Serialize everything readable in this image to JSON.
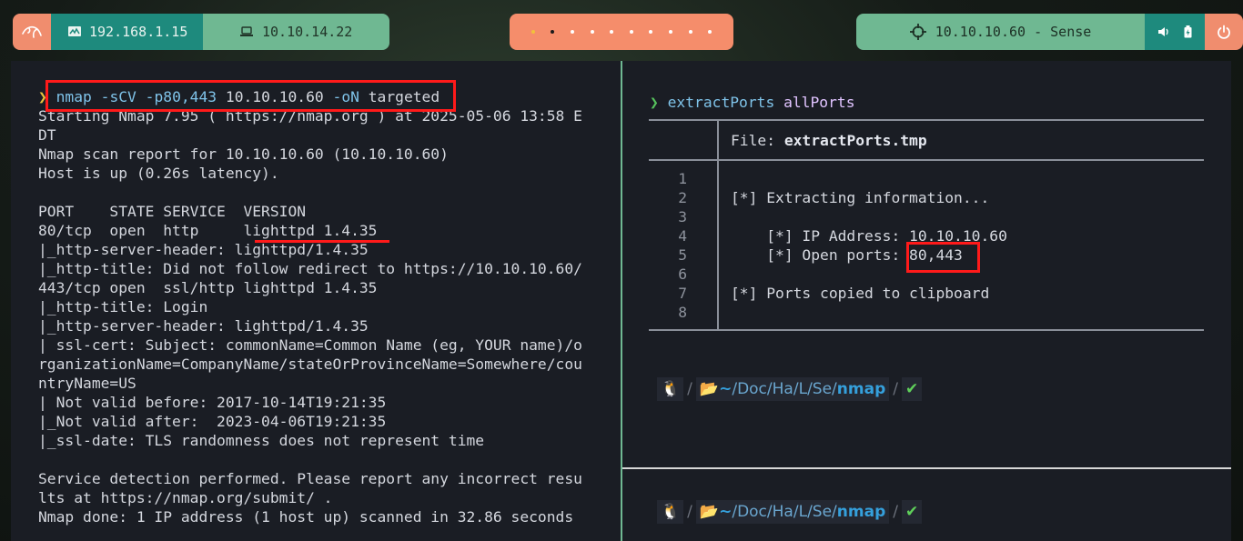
{
  "topbar": {
    "kali_icon": "kali-dragon-icon",
    "local_ip": "192.168.1.15",
    "vpn_ip": "10.10.14.22",
    "target": "10.10.10.60 - Sense",
    "workspaces_count": 10
  },
  "left_pane": {
    "prompt_arrow": "❯",
    "command": {
      "binary": "nmap",
      "args": " -sCV -p80,443 ",
      "ip": "10.10.10.60",
      "flag": " -oN ",
      "outfile": "targeted"
    },
    "output": [
      "Starting Nmap 7.95 ( https://nmap.org ) at 2025-05-06 13:58 E",
      "DT",
      "Nmap scan report for 10.10.10.60 (10.10.10.60)",
      "Host is up (0.26s latency).",
      "",
      "PORT    STATE SERVICE  VERSION",
      "80/tcp  open  http     lighttpd 1.4.35",
      "|_http-server-header: lighttpd/1.4.35",
      "|_http-title: Did not follow redirect to https://10.10.10.60/",
      "443/tcp open  ssl/http lighttpd 1.4.35",
      "|_http-title: Login",
      "|_http-server-header: lighttpd/1.4.35",
      "| ssl-cert: Subject: commonName=Common Name (eg, YOUR name)/o",
      "rganizationName=CompanyName/stateOrProvinceName=Somewhere/cou",
      "ntryName=US",
      "| Not valid before: 2017-10-14T19:21:35",
      "|_Not valid after:  2023-04-06T19:21:35",
      "|_ssl-date: TLS randomness does not represent time",
      "",
      "Service detection performed. Please report any incorrect resu",
      "lts at https://nmap.org/submit/ .",
      "Nmap done: 1 IP address (1 host up) scanned in 32.86 seconds"
    ]
  },
  "right_pane": {
    "prompt_arrow": "❯",
    "command": "extractPorts",
    "arg": "allPorts",
    "file_label": "File: ",
    "file_name": "extractPorts.tmp",
    "line_numbers": [
      "1",
      "2",
      "3",
      "4",
      "5",
      "6",
      "7",
      "8"
    ],
    "lines": [
      "",
      "[*] Extracting information...",
      "",
      "    [*] IP Address: 10.10.10.60",
      "    [*] Open ports: ",
      "",
      "[*] Ports copied to clipboard",
      ""
    ],
    "open_ports_value": "80,443",
    "breadcrumb": {
      "tilde": "~",
      "dirs": [
        "Doc",
        "Ha",
        "L",
        "Se"
      ],
      "current": "nmap",
      "check": "✔"
    }
  }
}
